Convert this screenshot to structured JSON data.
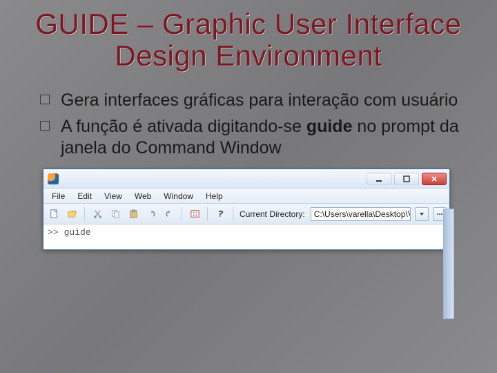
{
  "title": "GUIDE – Graphic User Interface Design Environment",
  "bullets": [
    "Gera interfaces gráficas para interação com usuário",
    "A função é ativada digitando-se guide no prompt da janela do Command Window"
  ],
  "bullet2_parts": {
    "pre": "A função é ativada digitando-se ",
    "kw": "guide",
    "post": " no prompt da janela do Command Window"
  },
  "matlab": {
    "menus": [
      "File",
      "Edit",
      "View",
      "Web",
      "Window",
      "Help"
    ],
    "cd_label": "Current Directory:",
    "cd_value": "C:\\Users\\varella\\Desktop\\V SE",
    "prompt": ">>",
    "command": "guide"
  }
}
